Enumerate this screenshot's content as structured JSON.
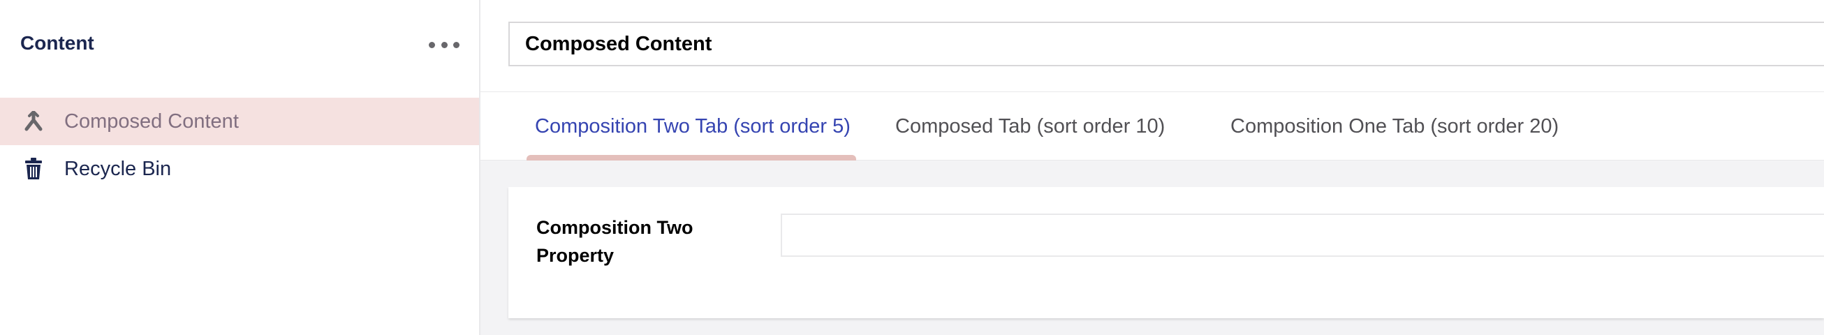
{
  "sidebar": {
    "title": "Content",
    "more_icon": "ellipsis-icon",
    "items": [
      {
        "label": "Composed Content",
        "icon": "composed-content-icon",
        "active": true
      },
      {
        "label": "Recycle Bin",
        "icon": "trash-icon",
        "active": false
      }
    ]
  },
  "editor": {
    "name_value": "Composed Content",
    "tabs": [
      {
        "label": "Composition Two Tab (sort order 5)",
        "active": true
      },
      {
        "label": "Composed Tab (sort order 10)",
        "active": false
      },
      {
        "label": "Composition One Tab (sort order 20)",
        "active": false
      }
    ],
    "property": {
      "label": "Composition Two Property",
      "value": ""
    }
  },
  "colors": {
    "active_tab_text": "#3544b1",
    "active_tab_underline": "#e4bfbb",
    "sidebar_active_bg": "#f5e1e0",
    "text_dark": "#1b264f"
  }
}
